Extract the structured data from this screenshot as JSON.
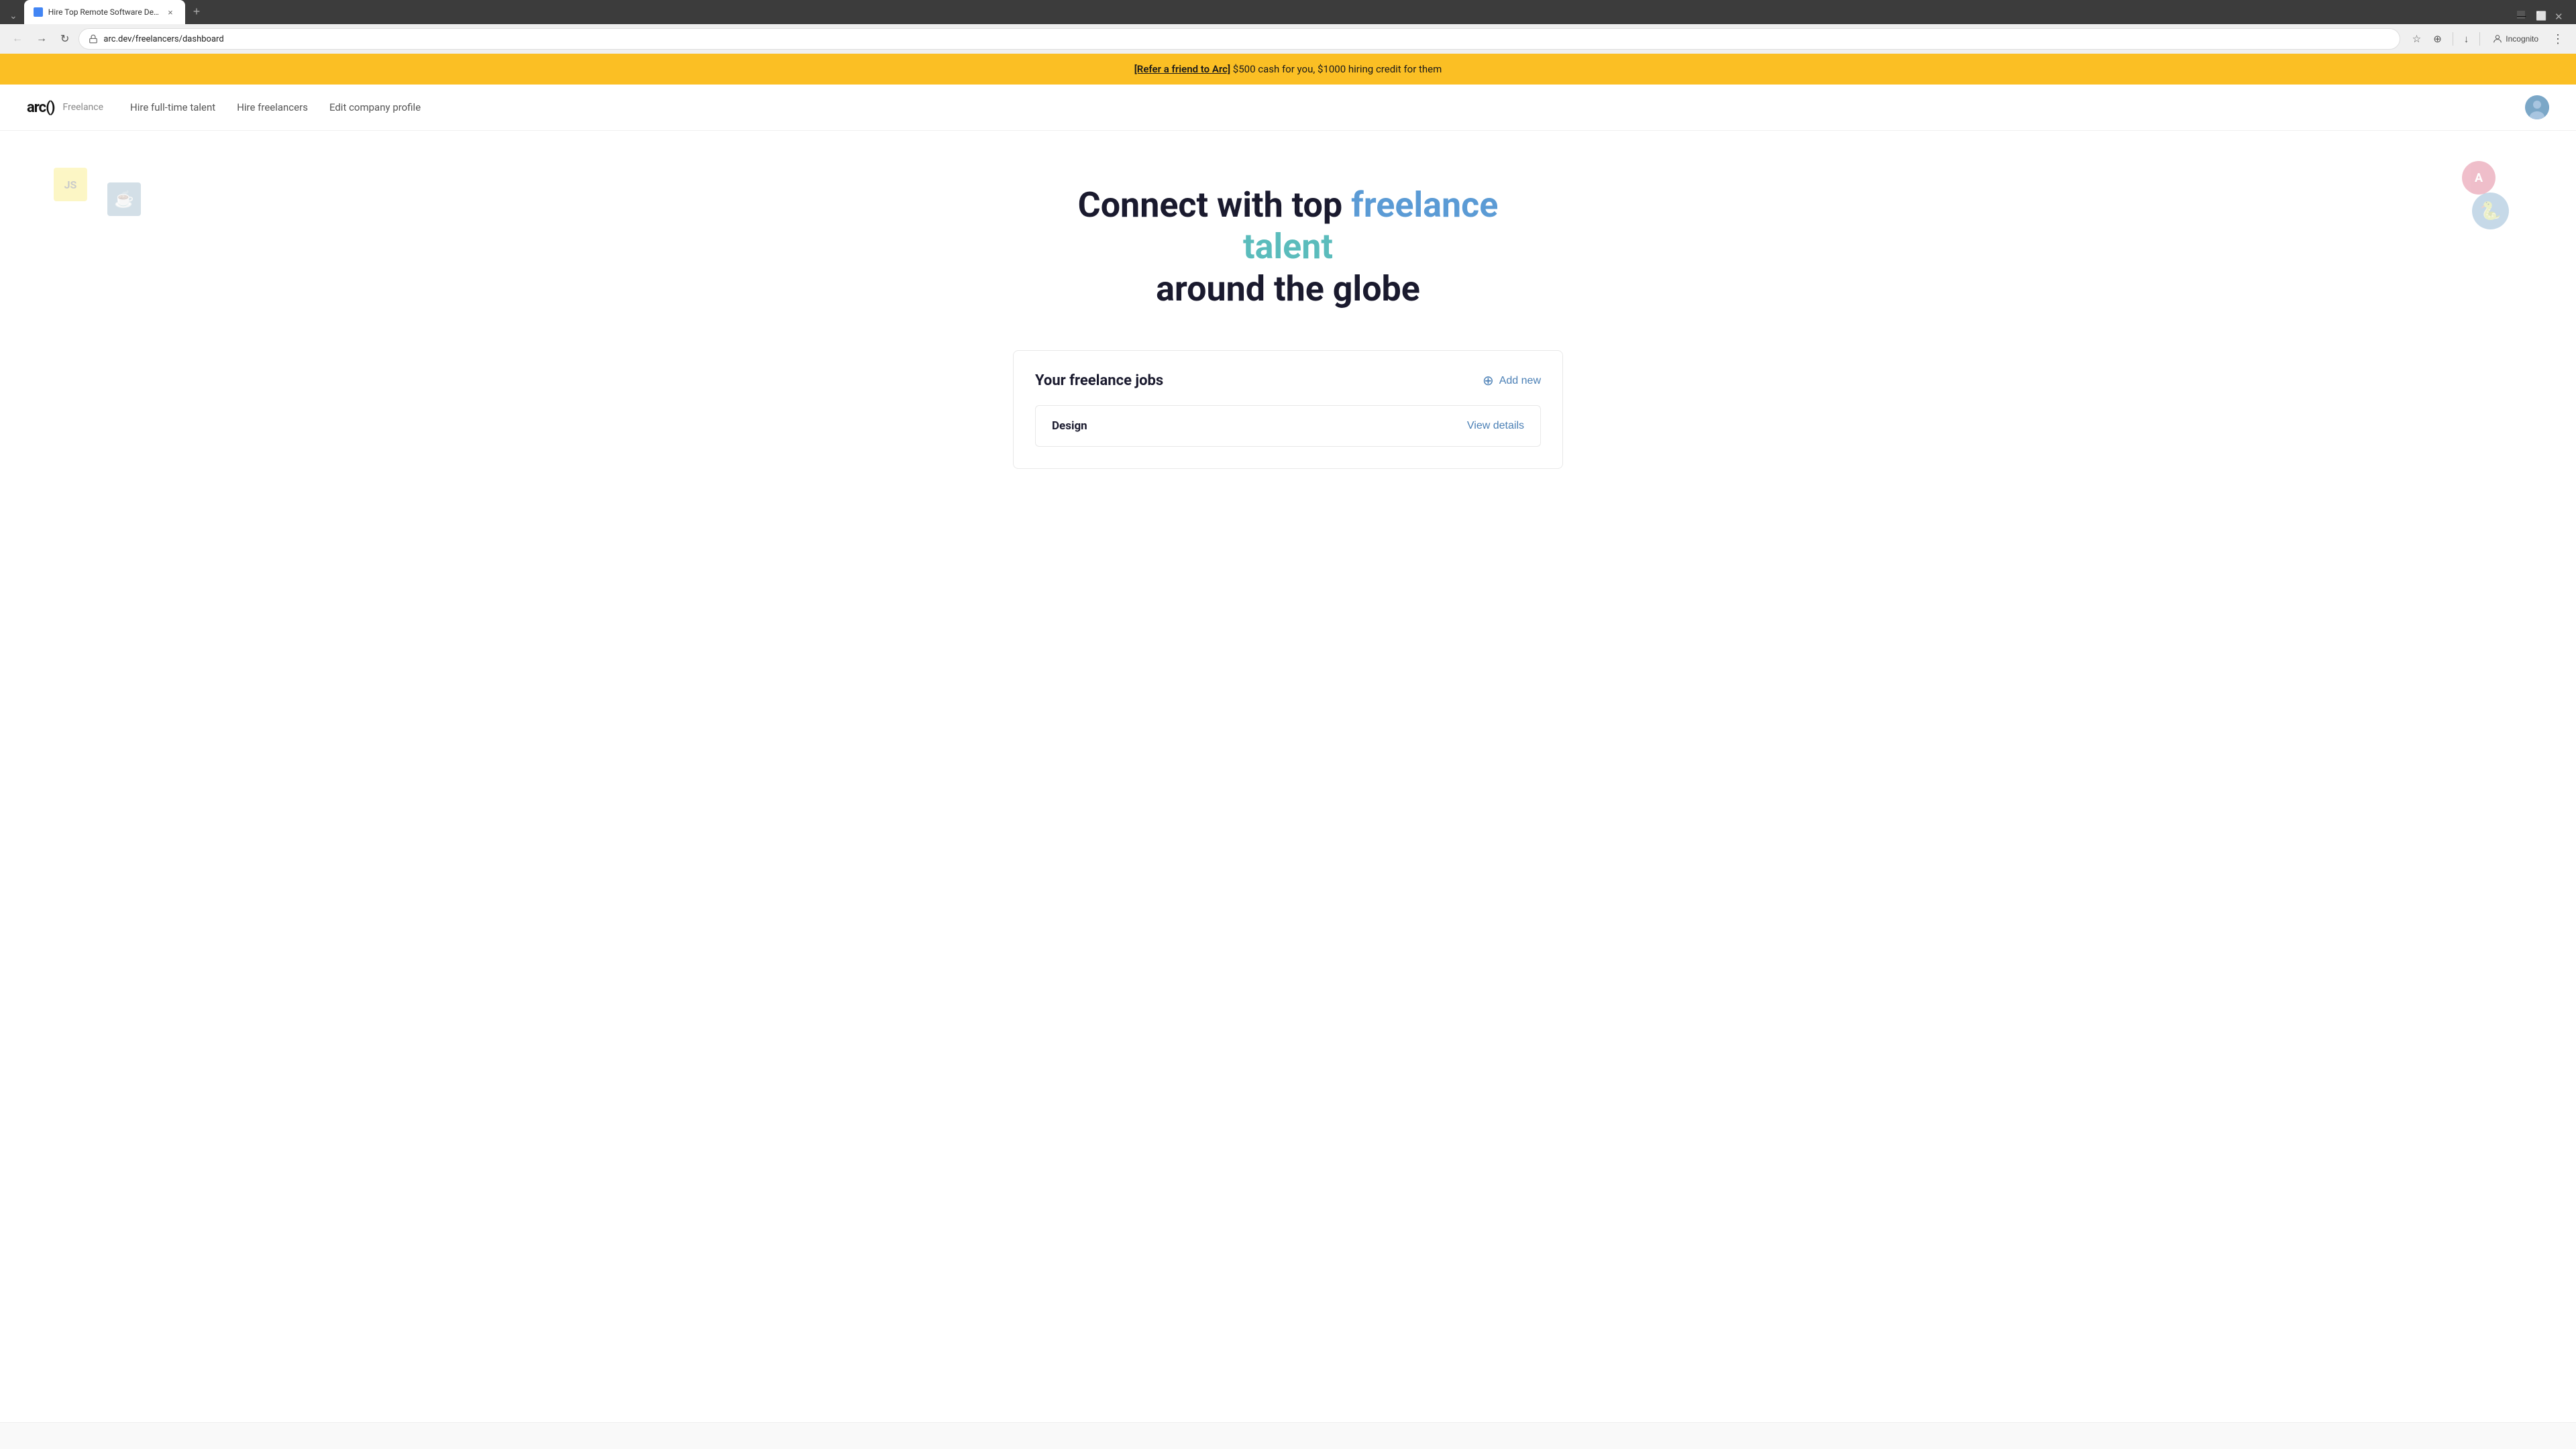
{
  "browser": {
    "tab_active_title": "Hire Top Remote Software Dev...",
    "tab_close_label": "×",
    "tab_new_label": "+",
    "nav_back_icon": "←",
    "nav_forward_icon": "→",
    "nav_refresh_icon": "↻",
    "address_url": "arc.dev/freelancers/dashboard",
    "nav_bookmark_icon": "☆",
    "nav_extensions_icon": "⊕",
    "nav_download_icon": "↓",
    "nav_incognito_label": "Incognito",
    "nav_more_icon": "⋮",
    "tab_dropdown_icon": "⌄"
  },
  "banner": {
    "link_text": "[Refer a friend to Arc]",
    "message": " $500 cash for you, $1000 hiring credit for them"
  },
  "header": {
    "logo_mark": "arc()",
    "logo_tagline": "Freelance",
    "nav_items": [
      {
        "label": "Hire full-time talent",
        "active": false
      },
      {
        "label": "Hire freelancers",
        "active": false
      },
      {
        "label": "Edit company profile",
        "active": false
      }
    ]
  },
  "hero": {
    "title_part1": "Connect with top ",
    "title_highlight1": "freelance talent",
    "title_part2": " around the globe",
    "icon_js": "JS",
    "icon_angular": "A",
    "icon_java": "☕",
    "icon_python": "🐍"
  },
  "jobs": {
    "section_title": "Your freelance jobs",
    "add_new_label": "Add new",
    "items": [
      {
        "name": "Design",
        "view_label": "View details"
      }
    ]
  },
  "colors": {
    "banner_bg": "#fbbf24",
    "hero_highlight1": "#5b9bd5",
    "hero_highlight2": "#6bc5c5",
    "link_blue": "#4a7fb5",
    "text_dark": "#1a1a2e"
  }
}
